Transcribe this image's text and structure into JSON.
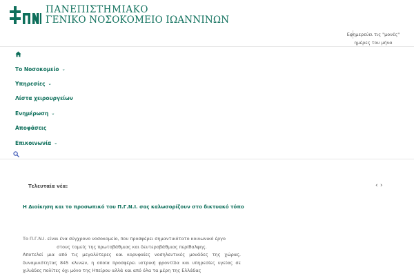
{
  "header": {
    "logo_line1": "ΠΑΝΕΠΙΣΤΗΜΙΑΚΟ",
    "logo_line2": "ΓΕΝΙΚΟ ΝΟΣΟΚΟΜΕΙΟ ΙΩΑΝΝΙΝΩΝ",
    "duty_line1": "Εφημερεύει τις \"μονές\"",
    "duty_line2": "ημέρες του μήνα"
  },
  "nav": {
    "items": [
      {
        "label": "Το Νοσοκομείο",
        "has_dropdown": true
      },
      {
        "label": "Υπηρεσίες",
        "has_dropdown": true
      },
      {
        "label": "Λίστα χειρουργείων",
        "has_dropdown": false
      },
      {
        "label": "Ενημέρωση",
        "has_dropdown": true
      },
      {
        "label": "Αποφάσεις",
        "has_dropdown": false
      },
      {
        "label": "Επικοινωνία",
        "has_dropdown": true
      }
    ],
    "chevron": "⌄",
    "home_icon": "home-icon",
    "search_icon": "search-icon"
  },
  "ticker": {
    "label": "Τελευταία νέα:",
    "prev": "‹",
    "next": "›"
  },
  "main": {
    "welcome": "Η Διοίκηση και το προσωπικό του Π.Γ.Ν.Ι. σας καλωσορίζουν στο δικτυακό τόπο",
    "about_line1": "Το Π.Γ.Ν.Ι. είναι ένα σύγχρονο νοσοκομείο, που προσφέρει σημαντικότατο κοινωνικό έργο",
    "about_line2": "στους τομείς της πρωτοβάθμιας και δευτεροβάθμιας περίθαλψης.",
    "about_line3": "Αποτελεί μια από τις μεγαλύτερες και κορυφαίες νοσηλευτικές μονάδες της χώρας, δυναμικότητας 845 κλινών, η οποία προσφέρει ιατρική φροντίδα και υπηρεσίες υγείας σε χιλιάδες πολίτες όχι μόνο της Ηπείρου αλλά και από όλα τα μέρη της Ελλάδας"
  },
  "colors": {
    "brand": "#0e6f5b",
    "text": "#555555"
  }
}
